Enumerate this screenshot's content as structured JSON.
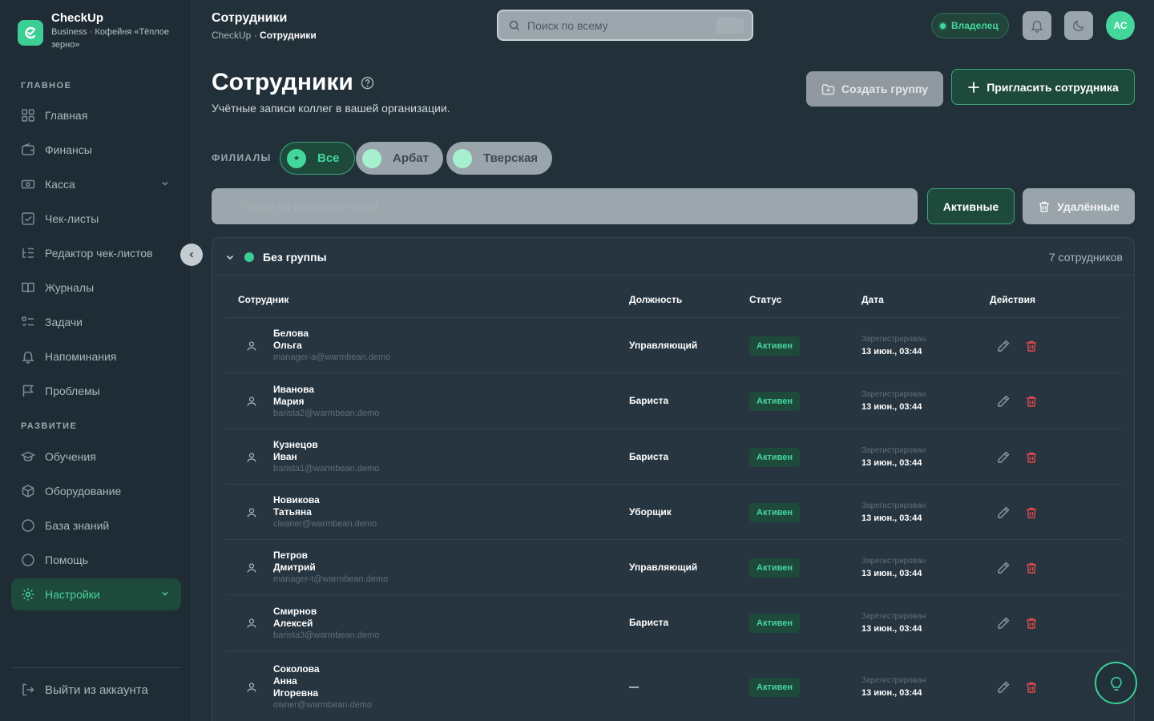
{
  "brand": {
    "name": "CheckUp",
    "subtitle": "Business · Кофейня «Тёплое зерно»"
  },
  "sidebar": {
    "sections": {
      "main": "ГЛАВНОЕ",
      "development": "РАЗВИТИЕ"
    },
    "items": [
      {
        "label": "Главная",
        "icon": "grid-icon"
      },
      {
        "label": "Финансы",
        "icon": "wallet-icon"
      },
      {
        "label": "Касса",
        "icon": "cash-icon",
        "expandable": true
      },
      {
        "label": "Чек-листы",
        "icon": "checklist-icon"
      },
      {
        "label": "Редактор чек-листов",
        "icon": "list-tree-icon"
      },
      {
        "label": "Журналы",
        "icon": "book-icon"
      },
      {
        "label": "Задачи",
        "icon": "tasks-icon"
      },
      {
        "label": "Напоминания",
        "icon": "bell-icon"
      },
      {
        "label": "Проблемы",
        "icon": "flag-icon"
      },
      {
        "label": "Обучения",
        "icon": "graduation-icon"
      },
      {
        "label": "Оборудование",
        "icon": "box-icon"
      },
      {
        "label": "База знаний",
        "icon": "circle-icon"
      },
      {
        "label": "Помощь",
        "icon": "circle-icon"
      },
      {
        "label": "Настройки",
        "icon": "gear-icon",
        "active": true,
        "expandable": true
      }
    ],
    "logout": "Выйти из аккаунта"
  },
  "topbar": {
    "title": "Сотрудники",
    "crumb_root": "CheckUp",
    "crumb_sep": " · ",
    "crumb_current": "Сотрудники",
    "search_placeholder": "Поиск по всему",
    "search_shortcut": "Ctrl K",
    "role": "Владелец",
    "avatar": "АС"
  },
  "main": {
    "title": "Сотрудники",
    "subtitle": "Учётные записи коллег в вашей организации.",
    "create_group": "Создать группу",
    "invite": "Пригласить сотрудника",
    "branches_label": "ФИЛИАЛЫ",
    "branches": [
      {
        "badge": "★",
        "label": "Все",
        "active": true
      },
      {
        "badge": "АР",
        "label": "Арбат",
        "active": false
      },
      {
        "badge": "ТВ",
        "label": "Тверская",
        "active": false
      }
    ],
    "list_search_placeholder": "Поиск по имени или email",
    "filter_active": "Активные",
    "filter_deleted": "Удалённые"
  },
  "group": {
    "name": "Без группы",
    "count": "7 сотрудников",
    "color": "#3ccf95",
    "columns": [
      "Сотрудник",
      "Должность",
      "Статус",
      "Дата",
      "Действия"
    ],
    "date_label": "Зарегистрирован",
    "rows": [
      {
        "name": [
          "Белова",
          "Ольга"
        ],
        "email": "manager-a@warmbean.demo",
        "role": "Управляющий",
        "status": "Активен",
        "date": "13 июн., 03:44"
      },
      {
        "name": [
          "Иванова",
          "Мария"
        ],
        "email": "barista2@warmbean.demo",
        "role": "Бариста",
        "status": "Активен",
        "date": "13 июн., 03:44"
      },
      {
        "name": [
          "Кузнецов",
          "Иван"
        ],
        "email": "barista1@warmbean.demo",
        "role": "Бариста",
        "status": "Активен",
        "date": "13 июн., 03:44"
      },
      {
        "name": [
          "Новикова",
          "Татьяна"
        ],
        "email": "cleaner@warmbean.demo",
        "role": "Уборщик",
        "status": "Активен",
        "date": "13 июн., 03:44"
      },
      {
        "name": [
          "Петров",
          "Дмитрий"
        ],
        "email": "manager-t@warmbean.demo",
        "role": "Управляющий",
        "status": "Активен",
        "date": "13 июн., 03:44"
      },
      {
        "name": [
          "Смирнов",
          "Алексей"
        ],
        "email": "barista3@warmbean.demo",
        "role": "Бариста",
        "status": "Активен",
        "date": "13 июн., 03:44"
      },
      {
        "name": [
          "Соколова",
          "Анна",
          "Игоревна"
        ],
        "email": "owner@warmbean.demo",
        "role": "—",
        "status": "Активен",
        "date": "13 июн., 03:44"
      }
    ]
  },
  "colors": {
    "accent": "#45d69c",
    "background": "#22303a",
    "danger": "#e5484d"
  }
}
